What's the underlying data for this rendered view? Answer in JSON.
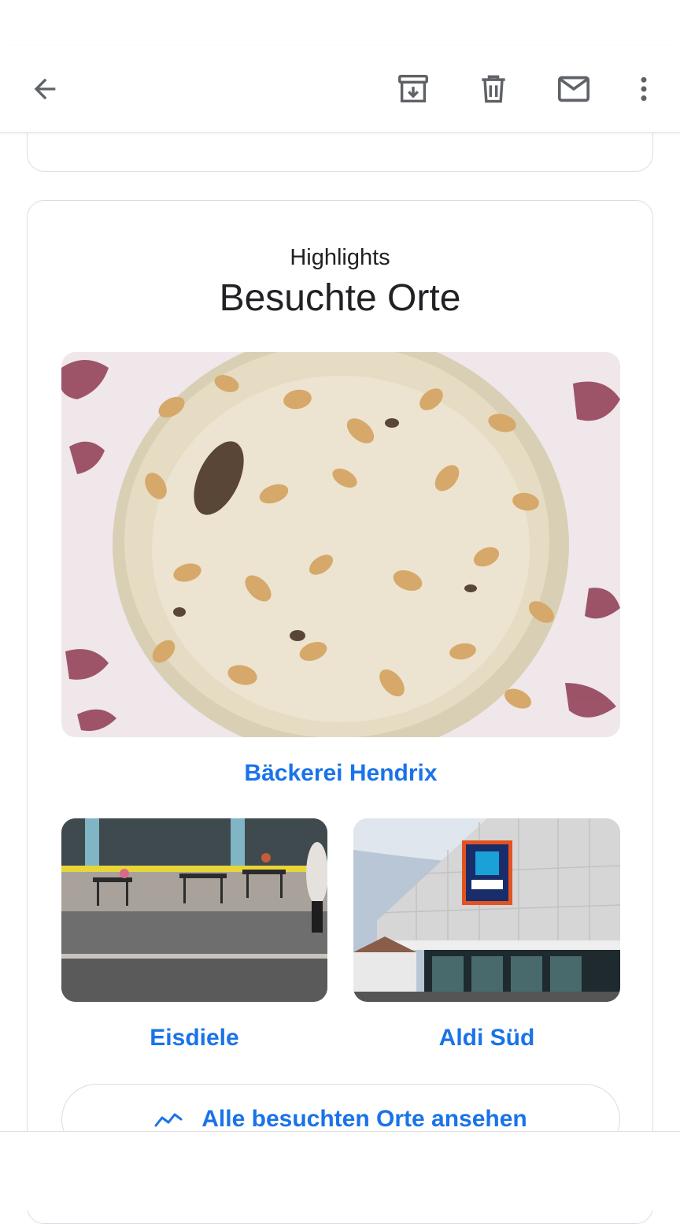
{
  "toolbar": {
    "back_icon": "arrow-back-icon",
    "archive_icon": "archive-icon",
    "delete_icon": "trash-icon",
    "mark_unread_icon": "mail-icon",
    "more_icon": "more-vert-icon"
  },
  "highlights": {
    "subtitle": "Highlights",
    "title": "Besuchte Orte",
    "places": [
      {
        "name": "Bäckerei Hendrix",
        "image": "bread-roll-photo"
      },
      {
        "name": "Eisdiele",
        "image": "ice-cafe-terrace-photo"
      },
      {
        "name": "Aldi Süd",
        "image": "aldi-store-photo"
      }
    ],
    "view_all_label": "Alle besuchten Orte ansehen",
    "view_all_icon": "timeline-icon"
  },
  "colors": {
    "link": "#1a73e8",
    "text": "#202124",
    "border": "#dadce0",
    "icon": "#5f6368"
  }
}
